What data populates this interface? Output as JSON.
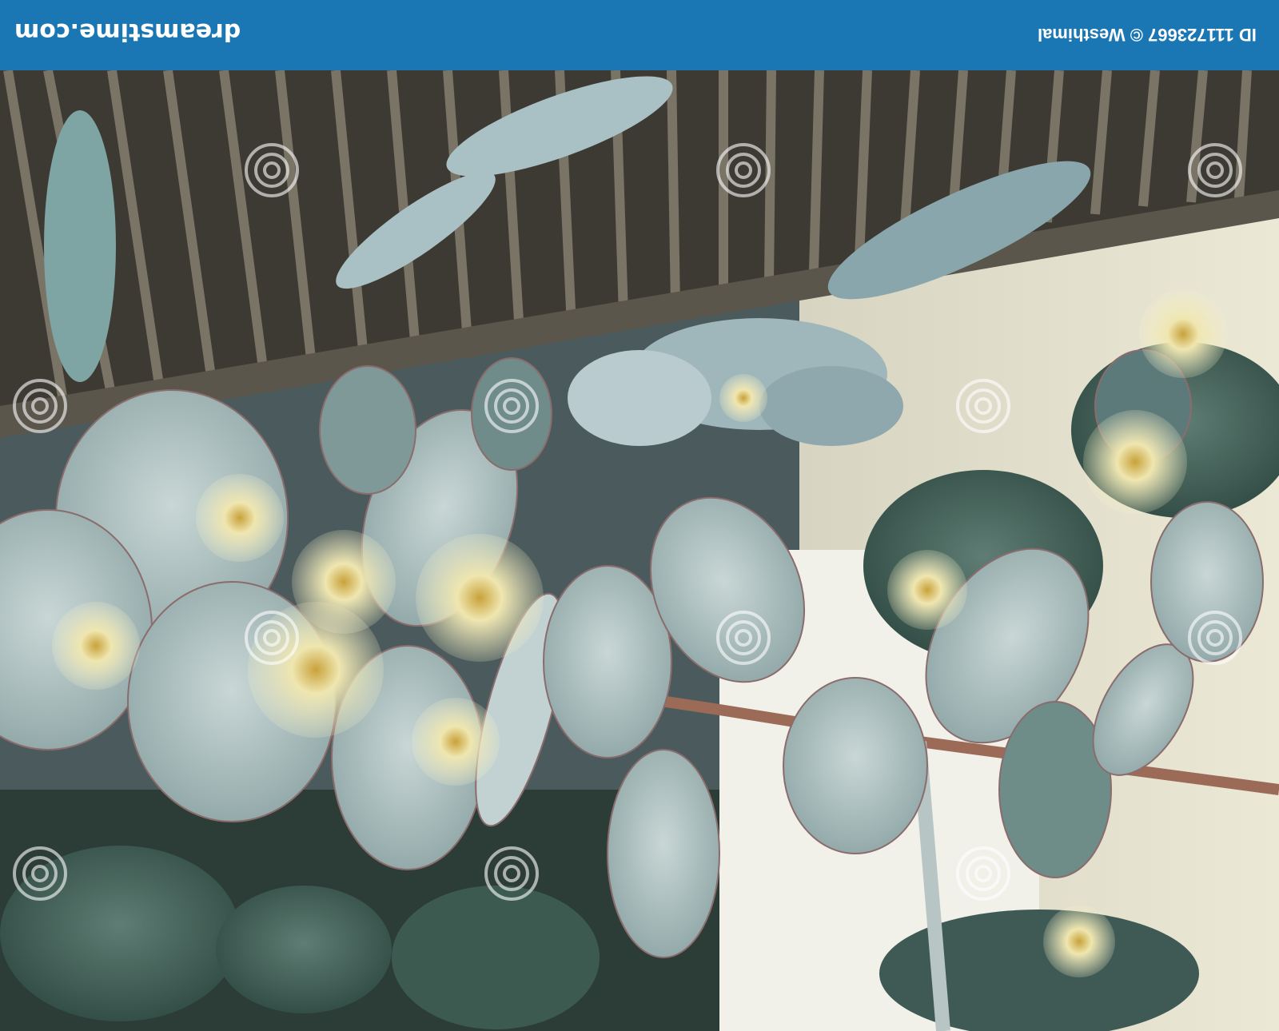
{
  "banner": {
    "color": "#1a77b3",
    "site_text": "dreamstime.com",
    "id_text": "ID 111723667 © Westhimal"
  },
  "photo": {
    "subject": "",
    "orientation": "upside-down"
  },
  "watermark": {
    "text": "dreamstime",
    "icon": "spiral-logo-icon"
  }
}
